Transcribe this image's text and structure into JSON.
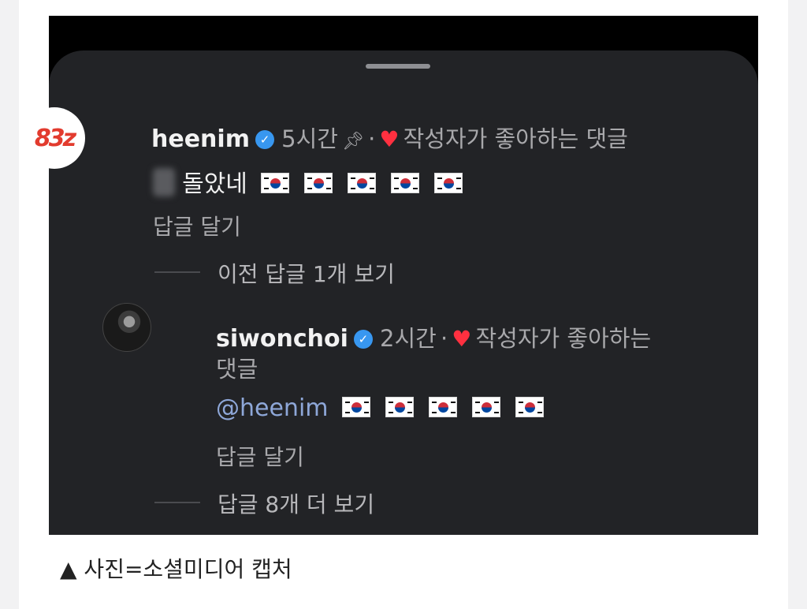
{
  "comment1": {
    "avatar_text": "83z",
    "username": "heenim",
    "time": "5시간",
    "separator": "·",
    "liked_label": "작성자가 좋아하는 댓글",
    "text": "돌았네",
    "flags": 5,
    "reply_label": "답글 달기",
    "view_previous": "이전 답글 1개 보기"
  },
  "comment2": {
    "username": "siwonchoi",
    "time": "2시간",
    "separator": "·",
    "liked_label_line1": "작성자가 좋아하는",
    "liked_label_line2": "댓글",
    "mention": "@heenim",
    "flags": 5,
    "reply_label": "답글 달기",
    "view_more": "답글 8개 더 보기"
  },
  "caption": "▲ 사진=소셜미디어 캡처",
  "colors": {
    "panel_bg": "#222326",
    "mention": "#8ea7d8",
    "heart": "#ff3040",
    "verified": "#3897f0"
  }
}
